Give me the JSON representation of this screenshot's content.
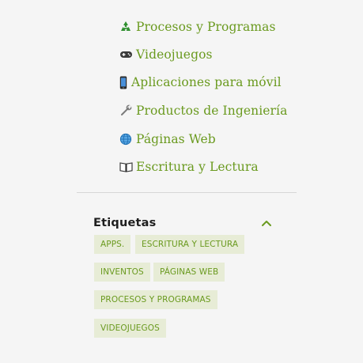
{
  "categories": [
    {
      "label": "Procesos y Programas",
      "icon": "recycle-icon"
    },
    {
      "label": "Videojuegos",
      "icon": "gamepad-icon"
    },
    {
      "label": "Aplicaciones para móvil",
      "icon": "mobile-phone-icon"
    },
    {
      "label": "Productos de Ingeniería",
      "icon": "wrench-icon"
    },
    {
      "label": "Páginas Web",
      "icon": "globe-icon"
    },
    {
      "label": "Escritura y Lectura",
      "icon": "open-book-icon"
    }
  ],
  "tags_section": {
    "title": "Etiquetas",
    "toggle_icon": "chevron-up-icon",
    "tags": [
      "APPS.",
      "ESCRITURA Y LECTURA",
      "INVENTOS",
      "PÁGINAS WEB",
      "PROCESOS Y PROGRAMAS",
      "VIDEOJUEGOS"
    ]
  },
  "colors": {
    "link": "#6a9a1f",
    "tag_background": "#e7ecd6",
    "title": "#1e1e1e",
    "background": "#f5f5f5",
    "divider": "#d6d6d6"
  }
}
